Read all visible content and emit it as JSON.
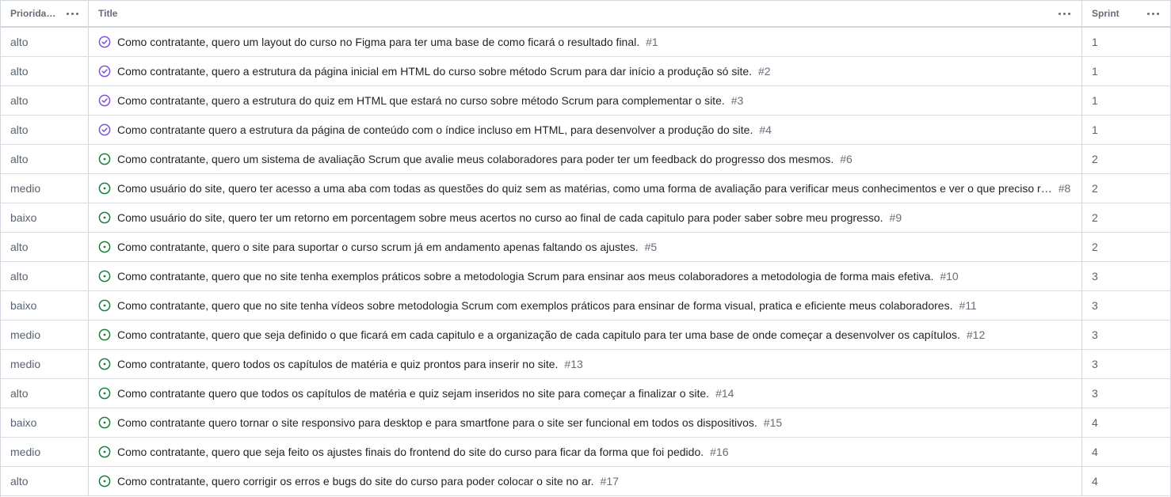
{
  "columns": {
    "priority": "Prioridade",
    "title": "Title",
    "sprint": "Sprint"
  },
  "colors": {
    "closed_icon": "#8250df",
    "open_icon": "#1a7f37",
    "border": "#d0d7de"
  },
  "rows": [
    {
      "priority": "alto",
      "title": "Como contratante, quero um layout do curso no Figma para ter uma base de como ficará o resultado final.",
      "number": "#1",
      "sprint": "1",
      "status": "closed",
      "icon": "check-circle-icon"
    },
    {
      "priority": "alto",
      "title": "Como contratante, quero a estrutura da página inicial em HTML do curso sobre método Scrum para dar início a produção só site.",
      "number": "#2",
      "sprint": "1",
      "status": "closed",
      "icon": "check-circle-icon"
    },
    {
      "priority": "alto",
      "title": "Como contratante, quero a estrutura do quiz em HTML que estará no curso sobre método Scrum para complementar o site.",
      "number": "#3",
      "sprint": "1",
      "status": "closed",
      "icon": "check-circle-icon"
    },
    {
      "priority": "alto",
      "title": "Como contratante quero a estrutura da página de conteúdo com o índice incluso em HTML, para desenvolver a produção do site.",
      "number": "#4",
      "sprint": "1",
      "status": "closed",
      "icon": "check-circle-icon"
    },
    {
      "priority": "alto",
      "title": "Como contratante, quero um sistema de avaliação Scrum que avalie meus colaboradores para poder ter um feedback do progresso dos mesmos.",
      "number": "#6",
      "sprint": "2",
      "status": "open",
      "icon": "issue-open-icon"
    },
    {
      "priority": "medio",
      "title": "Como usuário do site, quero ter acesso a uma aba com todas as questões do quiz sem as matérias, como uma forma de avaliação para verificar meus conhecimentos e ver o que preciso r…",
      "number": "#8",
      "sprint": "2",
      "status": "open",
      "icon": "issue-open-icon"
    },
    {
      "priority": "baixo",
      "title": "Como usuário do site, quero ter um retorno em porcentagem sobre meus acertos no curso ao final de cada capitulo para poder saber sobre meu progresso.",
      "number": "#9",
      "sprint": "2",
      "status": "open",
      "icon": "issue-open-icon"
    },
    {
      "priority": "alto",
      "title": "Como contratante, quero o site para suportar o curso scrum já em andamento apenas faltando os ajustes.",
      "number": "#5",
      "sprint": "2",
      "status": "open",
      "icon": "issue-open-icon"
    },
    {
      "priority": "alto",
      "title": "Como contratante, quero que no site tenha exemplos práticos sobre a metodologia Scrum para ensinar aos meus colaboradores a metodologia de forma mais efetiva.",
      "number": "#10",
      "sprint": "3",
      "status": "open",
      "icon": "issue-open-icon"
    },
    {
      "priority": "baixo",
      "title": "Como contratante, quero que no site tenha vídeos sobre metodologia Scrum com exemplos práticos para ensinar de forma visual, pratica e eficiente meus colaboradores.",
      "number": "#11",
      "sprint": "3",
      "status": "open",
      "icon": "issue-open-icon"
    },
    {
      "priority": "medio",
      "title": "Como contratante, quero que seja definido o que ficará em cada capitulo e a organização de cada capitulo para ter uma base de onde começar a desenvolver os capítulos.",
      "number": "#12",
      "sprint": "3",
      "status": "open",
      "icon": "issue-open-icon"
    },
    {
      "priority": "medio",
      "title": "Como contratante, quero todos os capítulos de matéria e quiz prontos para inserir no site.",
      "number": "#13",
      "sprint": "3",
      "status": "open",
      "icon": "issue-open-icon"
    },
    {
      "priority": "alto",
      "title": "Como contratante quero que todos os capítulos de matéria e quiz sejam inseridos no site para começar a finalizar o site.",
      "number": "#14",
      "sprint": "3",
      "status": "open",
      "icon": "issue-open-icon"
    },
    {
      "priority": "baixo",
      "title": "Como contratante quero tornar o site responsivo para desktop e para smartfone para o site ser funcional em todos os dispositivos.",
      "number": "#15",
      "sprint": "4",
      "status": "open",
      "icon": "issue-open-icon"
    },
    {
      "priority": "medio",
      "title": "Como contratante, quero que seja feito os ajustes finais do frontend do site do curso para ficar da forma que foi pedido.",
      "number": "#16",
      "sprint": "4",
      "status": "open",
      "icon": "issue-open-icon"
    },
    {
      "priority": "alto",
      "title": "Como contratante, quero corrigir os erros e bugs do site do curso para poder colocar o site no ar.",
      "number": "#17",
      "sprint": "4",
      "status": "open",
      "icon": "issue-open-icon"
    }
  ]
}
